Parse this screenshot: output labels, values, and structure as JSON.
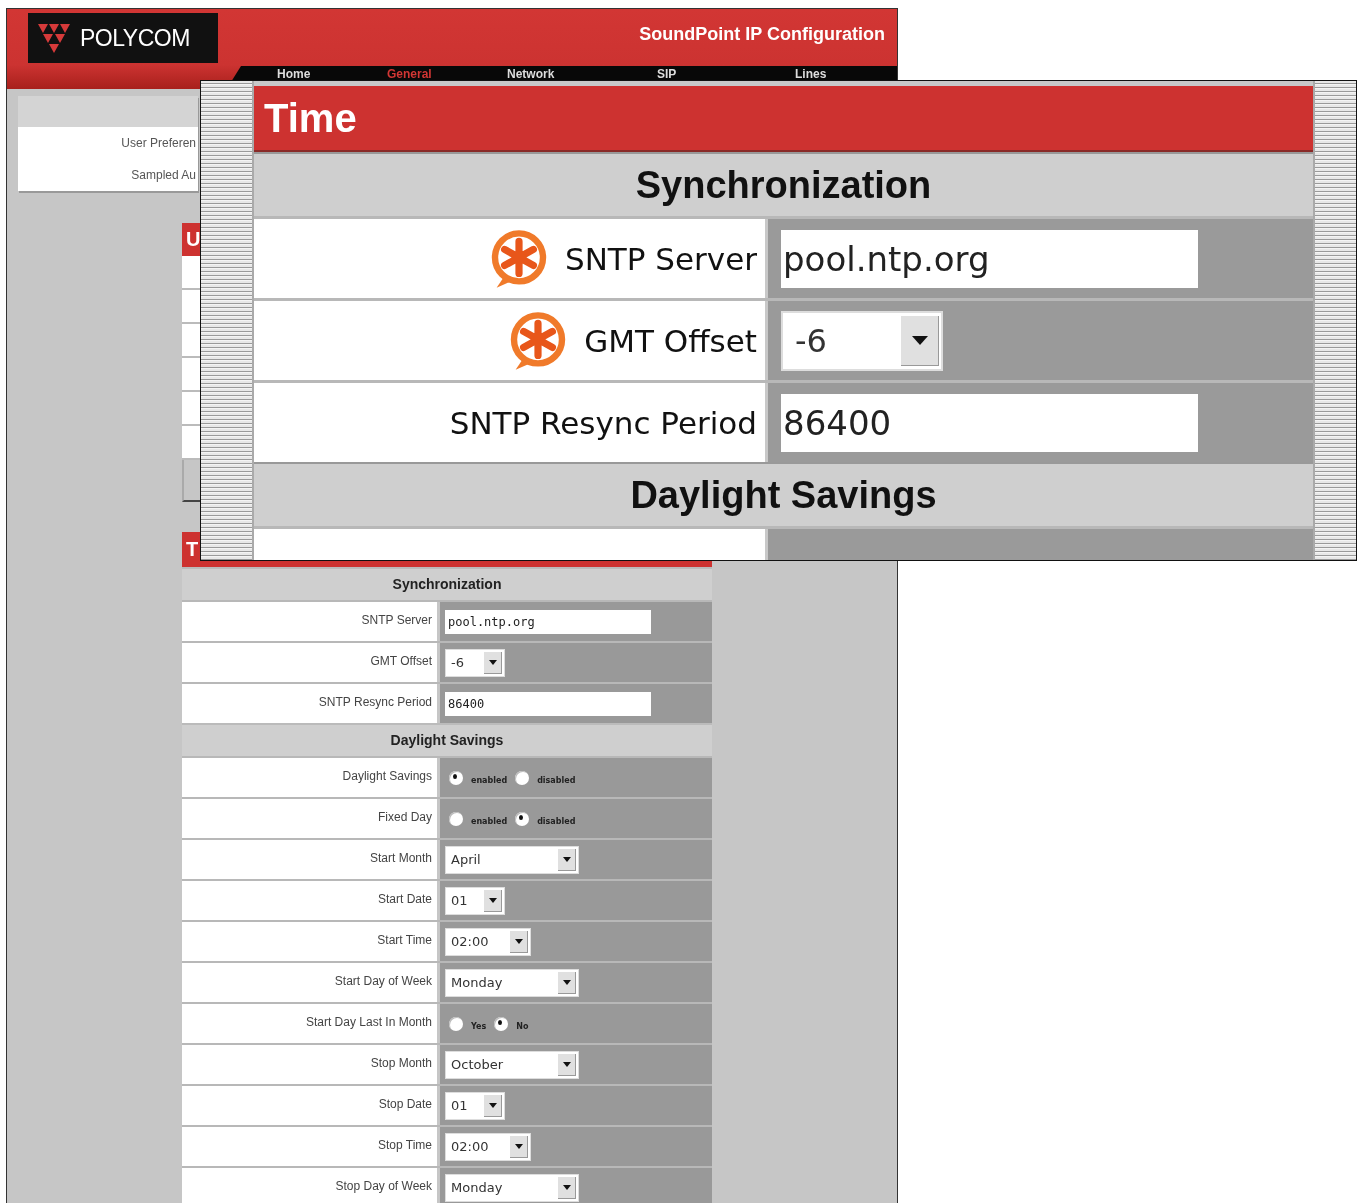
{
  "header": {
    "logo": "POLYCOM",
    "title": "SoundPoint IP Configuration"
  },
  "nav": [
    {
      "label": "Home",
      "selected": false
    },
    {
      "label": "General",
      "selected": true
    },
    {
      "label": "Network",
      "selected": false
    },
    {
      "label": "SIP",
      "selected": false
    },
    {
      "label": "Lines",
      "selected": false
    }
  ],
  "sidebar": {
    "items": [
      "User Preferen",
      "Sampled Au"
    ]
  },
  "user_panel": {
    "title": "U"
  },
  "time_panel": {
    "title": "T",
    "sections": [
      {
        "title": "Synchronization",
        "rows": [
          {
            "label": "SNTP Server",
            "kind": "text",
            "value": "pool.ntp.org"
          },
          {
            "label": "GMT Offset",
            "kind": "select",
            "value": "-6"
          },
          {
            "label": "SNTP Resync Period",
            "kind": "text",
            "value": "86400"
          }
        ]
      },
      {
        "title": "Daylight Savings",
        "rows": [
          {
            "label": "Daylight Savings",
            "kind": "radio",
            "options": [
              {
                "label": "enabled",
                "selected": true
              },
              {
                "label": "disabled",
                "selected": false
              }
            ]
          },
          {
            "label": "Fixed Day",
            "kind": "radio",
            "options": [
              {
                "label": "enabled",
                "selected": false
              },
              {
                "label": "disabled",
                "selected": true
              }
            ]
          },
          {
            "label": "Start Month",
            "kind": "select",
            "value": "April"
          },
          {
            "label": "Start Date",
            "kind": "select",
            "value": "01"
          },
          {
            "label": "Start Time",
            "kind": "select",
            "value": "02:00"
          },
          {
            "label": "Start Day of Week",
            "kind": "select",
            "value": "Monday"
          },
          {
            "label": "Start Day Last In Month",
            "kind": "radio",
            "options": [
              {
                "label": "Yes",
                "selected": false
              },
              {
                "label": "No",
                "selected": true
              }
            ]
          },
          {
            "label": "Stop Month",
            "kind": "select",
            "value": "October"
          },
          {
            "label": "Stop Date",
            "kind": "select",
            "value": "01"
          },
          {
            "label": "Stop Time",
            "kind": "select",
            "value": "02:00"
          },
          {
            "label": "Stop Day of Week",
            "kind": "select",
            "value": "Monday"
          }
        ]
      }
    ]
  },
  "callout": {
    "title": "Time",
    "sections": [
      {
        "title": "Synchronization",
        "rows": [
          {
            "label": "SNTP Server",
            "required": true,
            "kind": "text",
            "value": "pool.ntp.org"
          },
          {
            "label": "GMT Offset",
            "required": true,
            "kind": "select",
            "value": "-6"
          },
          {
            "label": "SNTP Resync Period",
            "required": false,
            "kind": "text",
            "value": "86400"
          }
        ]
      },
      {
        "title": "Daylight Savings"
      }
    ]
  }
}
